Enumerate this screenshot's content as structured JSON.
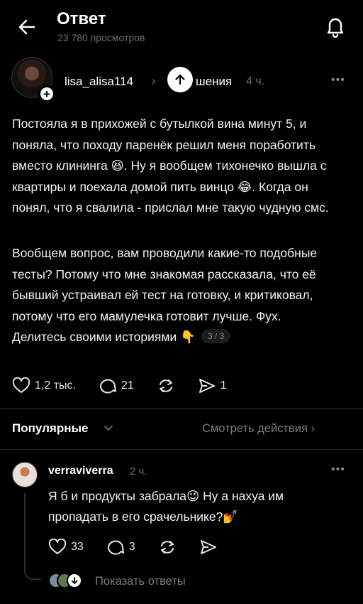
{
  "header": {
    "title": "Ответ",
    "views": "23 780 просмотров",
    "back_icon": "arrow-left-icon",
    "bell_icon": "bell-icon"
  },
  "post": {
    "username": "lisa_alisa114",
    "topic_fragment": "шения",
    "time": "4 ч.",
    "paragraph1": "Постояла я в прихожей с бутылкой вина минут 5, и поняла, что походу паренёк решил меня поработить вместо клининга 😆. Ну я вообщем тихонечко вышла с квартиры и поехала домой пить винцо 😂. Когда он понял, что я свалила - прислал мне такую чудную смс.",
    "paragraph2": "Вообщем вопрос, вам проводили какие-то подобные тесты? Потому что мне знакомая рассказала, что её бывший устраивал ей тест на готовку, и критиковал, потому что его мамулечка готовит лучше. Фух. Делитесь своими историями 👇",
    "pager": "3 / 3",
    "likes": "1,2 тыс.",
    "comments": "21",
    "shares": "1"
  },
  "sort": {
    "label": "Популярные",
    "activity_link": "Смотреть действия"
  },
  "comment": {
    "username": "verraviverra",
    "time": "2 ч.",
    "text": "Я б и продукты забрала😉 Ну а нахуа им пропадать в его срачельнике?💅",
    "likes": "33",
    "comments": "3",
    "show_replies": "Показать ответы"
  },
  "colors": {
    "background": "#000000",
    "text": "#f2f2f2",
    "muted": "#6f6f6f",
    "divider": "#262626"
  }
}
